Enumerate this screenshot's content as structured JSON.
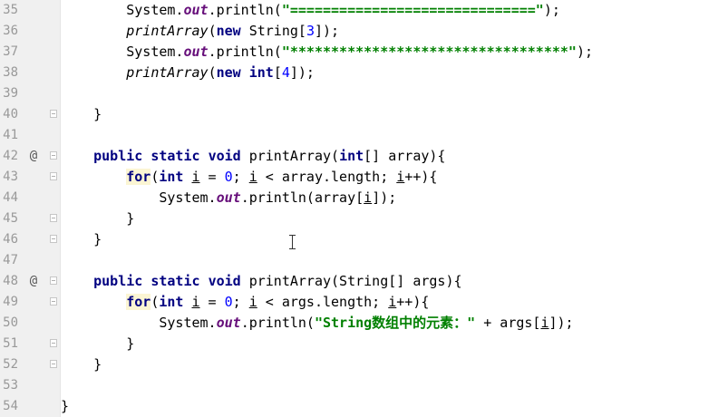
{
  "editor": {
    "lines": [
      {
        "number": "35",
        "override": "",
        "fold": false,
        "segments": [
          {
            "text": "        System.",
            "style": "plain"
          },
          {
            "text": "out",
            "style": "static-field"
          },
          {
            "text": ".println(",
            "style": "plain"
          },
          {
            "text": "\"==============================\"",
            "style": "string"
          },
          {
            "text": ");",
            "style": "plain"
          }
        ]
      },
      {
        "number": "36",
        "override": "",
        "fold": false,
        "segments": [
          {
            "text": "        ",
            "style": "plain"
          },
          {
            "text": "printArray",
            "style": "static-call"
          },
          {
            "text": "(",
            "style": "plain"
          },
          {
            "text": "new",
            "style": "keyword"
          },
          {
            "text": " String[",
            "style": "plain"
          },
          {
            "text": "3",
            "style": "number"
          },
          {
            "text": "]);",
            "style": "plain"
          }
        ]
      },
      {
        "number": "37",
        "override": "",
        "fold": false,
        "segments": [
          {
            "text": "        System.",
            "style": "plain"
          },
          {
            "text": "out",
            "style": "static-field"
          },
          {
            "text": ".println(",
            "style": "plain"
          },
          {
            "text": "\"**********************************\"",
            "style": "string"
          },
          {
            "text": ");",
            "style": "plain"
          }
        ]
      },
      {
        "number": "38",
        "override": "",
        "fold": false,
        "segments": [
          {
            "text": "        ",
            "style": "plain"
          },
          {
            "text": "printArray",
            "style": "static-call"
          },
          {
            "text": "(",
            "style": "plain"
          },
          {
            "text": "new",
            "style": "keyword"
          },
          {
            "text": " ",
            "style": "plain"
          },
          {
            "text": "int",
            "style": "keyword"
          },
          {
            "text": "[",
            "style": "plain"
          },
          {
            "text": "4",
            "style": "number"
          },
          {
            "text": "]);",
            "style": "plain"
          }
        ]
      },
      {
        "number": "39",
        "override": "",
        "fold": false,
        "segments": []
      },
      {
        "number": "40",
        "override": "",
        "fold": true,
        "segments": [
          {
            "text": "    }",
            "style": "plain"
          }
        ]
      },
      {
        "number": "41",
        "override": "",
        "fold": false,
        "segments": []
      },
      {
        "number": "42",
        "override": "@",
        "fold": true,
        "segments": [
          {
            "text": "    ",
            "style": "plain"
          },
          {
            "text": "public",
            "style": "keyword"
          },
          {
            "text": " ",
            "style": "plain"
          },
          {
            "text": "static",
            "style": "keyword"
          },
          {
            "text": " ",
            "style": "plain"
          },
          {
            "text": "void",
            "style": "keyword"
          },
          {
            "text": " printArray(",
            "style": "plain"
          },
          {
            "text": "int",
            "style": "keyword"
          },
          {
            "text": "[] array){",
            "style": "plain"
          }
        ]
      },
      {
        "number": "43",
        "override": "",
        "fold": true,
        "segments": [
          {
            "text": "        ",
            "style": "plain"
          },
          {
            "text": "for",
            "style": "keyword-highlight"
          },
          {
            "text": "(",
            "style": "plain"
          },
          {
            "text": "int",
            "style": "keyword"
          },
          {
            "text": " ",
            "style": "plain"
          },
          {
            "text": "i",
            "style": "underline"
          },
          {
            "text": " = ",
            "style": "plain"
          },
          {
            "text": "0",
            "style": "number"
          },
          {
            "text": "; ",
            "style": "plain"
          },
          {
            "text": "i",
            "style": "underline"
          },
          {
            "text": " < array.length; ",
            "style": "plain"
          },
          {
            "text": "i",
            "style": "underline"
          },
          {
            "text": "++){",
            "style": "plain"
          }
        ]
      },
      {
        "number": "44",
        "override": "",
        "fold": false,
        "segments": [
          {
            "text": "            System.",
            "style": "plain"
          },
          {
            "text": "out",
            "style": "static-field"
          },
          {
            "text": ".println(array[",
            "style": "plain"
          },
          {
            "text": "i",
            "style": "underline"
          },
          {
            "text": "]);",
            "style": "plain"
          }
        ]
      },
      {
        "number": "45",
        "override": "",
        "fold": true,
        "segments": [
          {
            "text": "        }",
            "style": "plain"
          }
        ]
      },
      {
        "number": "46",
        "override": "",
        "fold": true,
        "segments": [
          {
            "text": "    }",
            "style": "plain"
          }
        ]
      },
      {
        "number": "47",
        "override": "",
        "fold": false,
        "segments": []
      },
      {
        "number": "48",
        "override": "@",
        "fold": true,
        "segments": [
          {
            "text": "    ",
            "style": "plain"
          },
          {
            "text": "public",
            "style": "keyword"
          },
          {
            "text": " ",
            "style": "plain"
          },
          {
            "text": "static",
            "style": "keyword"
          },
          {
            "text": " ",
            "style": "plain"
          },
          {
            "text": "void",
            "style": "keyword"
          },
          {
            "text": " printArray(String[] args){",
            "style": "plain"
          }
        ]
      },
      {
        "number": "49",
        "override": "",
        "fold": true,
        "segments": [
          {
            "text": "        ",
            "style": "plain"
          },
          {
            "text": "for",
            "style": "keyword-highlight"
          },
          {
            "text": "(",
            "style": "plain"
          },
          {
            "text": "int",
            "style": "keyword"
          },
          {
            "text": " ",
            "style": "plain"
          },
          {
            "text": "i",
            "style": "underline"
          },
          {
            "text": " = ",
            "style": "plain"
          },
          {
            "text": "0",
            "style": "number"
          },
          {
            "text": "; ",
            "style": "plain"
          },
          {
            "text": "i",
            "style": "underline"
          },
          {
            "text": " < args.length; ",
            "style": "plain"
          },
          {
            "text": "i",
            "style": "underline"
          },
          {
            "text": "++){",
            "style": "plain"
          }
        ]
      },
      {
        "number": "50",
        "override": "",
        "fold": false,
        "segments": [
          {
            "text": "            System.",
            "style": "plain"
          },
          {
            "text": "out",
            "style": "static-field"
          },
          {
            "text": ".println(",
            "style": "plain"
          },
          {
            "text": "\"String数组中的元素：\"",
            "style": "string"
          },
          {
            "text": " + args[",
            "style": "plain"
          },
          {
            "text": "i",
            "style": "underline"
          },
          {
            "text": "]);",
            "style": "plain"
          }
        ]
      },
      {
        "number": "51",
        "override": "",
        "fold": true,
        "segments": [
          {
            "text": "        }",
            "style": "plain"
          }
        ]
      },
      {
        "number": "52",
        "override": "",
        "fold": true,
        "segments": [
          {
            "text": "    }",
            "style": "plain"
          }
        ]
      },
      {
        "number": "53",
        "override": "",
        "fold": false,
        "segments": []
      },
      {
        "number": "54",
        "override": "",
        "fold": false,
        "segments": [
          {
            "text": "}",
            "style": "plain"
          }
        ]
      }
    ]
  },
  "colors": {
    "keyword": "#000080",
    "string": "#008000",
    "number": "#0000ff",
    "static_field": "#660e7a",
    "line_number": "#999999",
    "gutter_background": "#f0f0f0",
    "for_highlight": "#fbf5d3"
  },
  "icons": {
    "override_marker": "at-sign-icon",
    "fold_marker": "fold-collapse-icon",
    "cursor": "text-cursor-icon"
  }
}
